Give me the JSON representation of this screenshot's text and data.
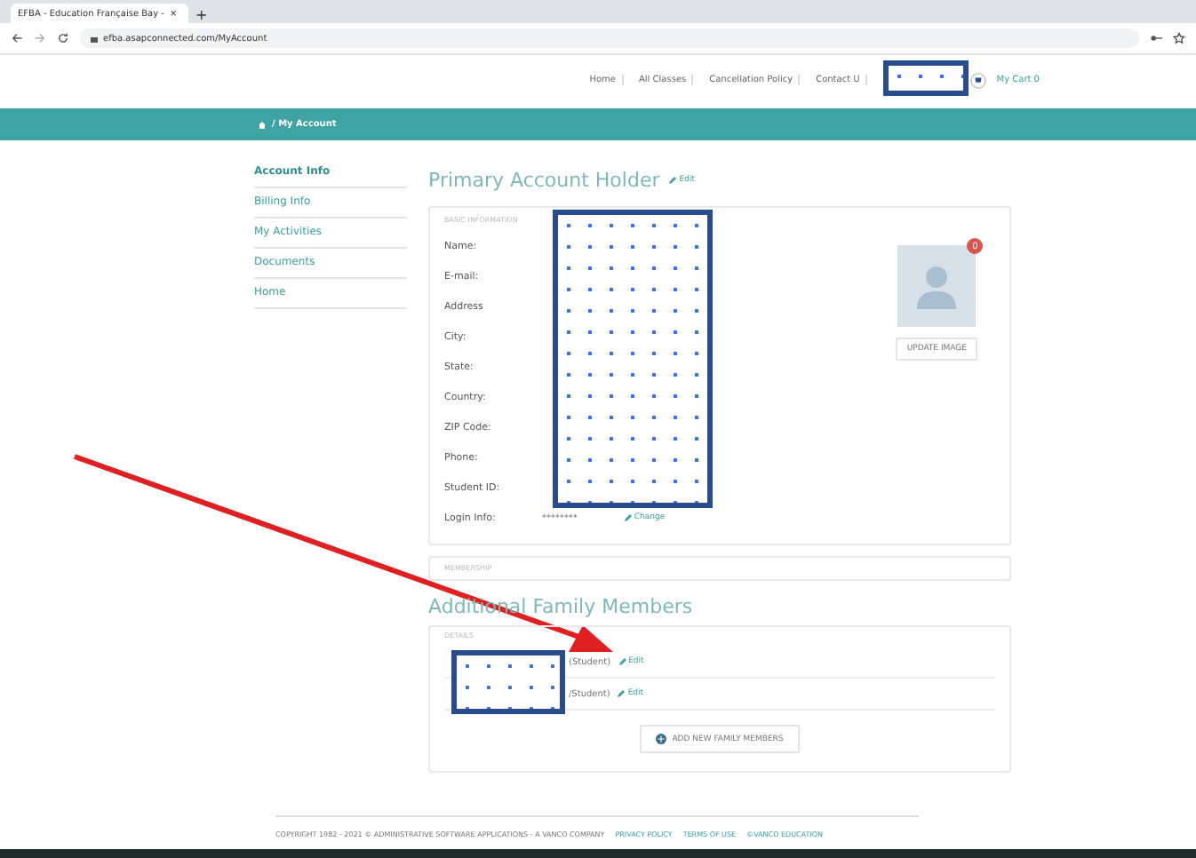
{
  "browser": {
    "tabs": [
      {
        "label": "EFBA - Education Française Bay -",
        "selected": true
      }
    ],
    "new_tab": "+",
    "close": "×",
    "url": "efba.asapconnected.com/MyAccount"
  },
  "nav": {
    "links": [
      "Home",
      "All Classes",
      "Cancellation Policy",
      "Contact U"
    ],
    "cart": "My Cart 0"
  },
  "breadcrumb": "/ My Account",
  "sidebar": {
    "items": [
      {
        "label": "Account Info",
        "selected": true
      },
      {
        "label": "Billing Info",
        "selected": false
      },
      {
        "label": "My Activities",
        "selected": false
      },
      {
        "label": "Documents",
        "selected": false
      },
      {
        "label": "Home",
        "selected": false
      }
    ]
  },
  "primary": {
    "title": "Primary Account Holder",
    "edit": "Edit",
    "section": "BASIC INFORMATION",
    "fields": [
      "Name:",
      "E-mail:",
      "Address",
      "City:",
      "State:",
      "Country:",
      "ZIP Code:",
      "Phone:",
      "Student ID:"
    ],
    "login": {
      "label": "Login Info:",
      "value": "********",
      "action": "Change"
    },
    "photo": {
      "badge": "0",
      "button": "UPDATE IMAGE"
    }
  },
  "membership": {
    "section": "MEMBERSHIP"
  },
  "family": {
    "title": "Additional Family Members",
    "section": "DETAILS",
    "members": [
      {
        "role": "(Student)",
        "edit": "Edit"
      },
      {
        "role": "/Student)",
        "edit": "Edit"
      }
    ],
    "add_button": "ADD NEW FAMILY MEMBERS"
  },
  "footer": {
    "copyright": "COPYRIGHT 1982 - 2021 © ADMINISTRATIVE SOFTWARE APPLICATIONS - A VANCO COMPANY",
    "links": [
      "PRIVACY POLICY",
      "TERMS OF USE",
      "©VANCO EDUCATION"
    ]
  },
  "annotations": [
    {
      "kind": "redaction"
    },
    {
      "kind": "redaction"
    },
    {
      "kind": "redaction"
    },
    {
      "kind": "arrow"
    }
  ]
}
